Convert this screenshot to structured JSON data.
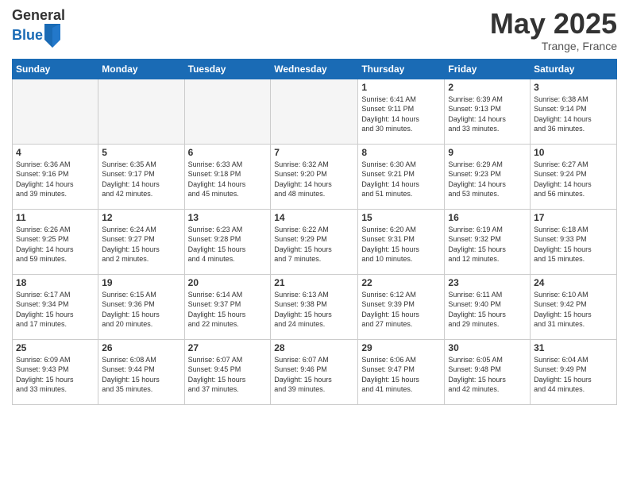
{
  "header": {
    "logo_general": "General",
    "logo_blue": "Blue",
    "month_title": "May 2025",
    "location": "Trange, France"
  },
  "weekdays": [
    "Sunday",
    "Monday",
    "Tuesday",
    "Wednesday",
    "Thursday",
    "Friday",
    "Saturday"
  ],
  "weeks": [
    [
      {
        "day": "",
        "info": ""
      },
      {
        "day": "",
        "info": ""
      },
      {
        "day": "",
        "info": ""
      },
      {
        "day": "",
        "info": ""
      },
      {
        "day": "1",
        "info": "Sunrise: 6:41 AM\nSunset: 9:11 PM\nDaylight: 14 hours\nand 30 minutes."
      },
      {
        "day": "2",
        "info": "Sunrise: 6:39 AM\nSunset: 9:13 PM\nDaylight: 14 hours\nand 33 minutes."
      },
      {
        "day": "3",
        "info": "Sunrise: 6:38 AM\nSunset: 9:14 PM\nDaylight: 14 hours\nand 36 minutes."
      }
    ],
    [
      {
        "day": "4",
        "info": "Sunrise: 6:36 AM\nSunset: 9:16 PM\nDaylight: 14 hours\nand 39 minutes."
      },
      {
        "day": "5",
        "info": "Sunrise: 6:35 AM\nSunset: 9:17 PM\nDaylight: 14 hours\nand 42 minutes."
      },
      {
        "day": "6",
        "info": "Sunrise: 6:33 AM\nSunset: 9:18 PM\nDaylight: 14 hours\nand 45 minutes."
      },
      {
        "day": "7",
        "info": "Sunrise: 6:32 AM\nSunset: 9:20 PM\nDaylight: 14 hours\nand 48 minutes."
      },
      {
        "day": "8",
        "info": "Sunrise: 6:30 AM\nSunset: 9:21 PM\nDaylight: 14 hours\nand 51 minutes."
      },
      {
        "day": "9",
        "info": "Sunrise: 6:29 AM\nSunset: 9:23 PM\nDaylight: 14 hours\nand 53 minutes."
      },
      {
        "day": "10",
        "info": "Sunrise: 6:27 AM\nSunset: 9:24 PM\nDaylight: 14 hours\nand 56 minutes."
      }
    ],
    [
      {
        "day": "11",
        "info": "Sunrise: 6:26 AM\nSunset: 9:25 PM\nDaylight: 14 hours\nand 59 minutes."
      },
      {
        "day": "12",
        "info": "Sunrise: 6:24 AM\nSunset: 9:27 PM\nDaylight: 15 hours\nand 2 minutes."
      },
      {
        "day": "13",
        "info": "Sunrise: 6:23 AM\nSunset: 9:28 PM\nDaylight: 15 hours\nand 4 minutes."
      },
      {
        "day": "14",
        "info": "Sunrise: 6:22 AM\nSunset: 9:29 PM\nDaylight: 15 hours\nand 7 minutes."
      },
      {
        "day": "15",
        "info": "Sunrise: 6:20 AM\nSunset: 9:31 PM\nDaylight: 15 hours\nand 10 minutes."
      },
      {
        "day": "16",
        "info": "Sunrise: 6:19 AM\nSunset: 9:32 PM\nDaylight: 15 hours\nand 12 minutes."
      },
      {
        "day": "17",
        "info": "Sunrise: 6:18 AM\nSunset: 9:33 PM\nDaylight: 15 hours\nand 15 minutes."
      }
    ],
    [
      {
        "day": "18",
        "info": "Sunrise: 6:17 AM\nSunset: 9:34 PM\nDaylight: 15 hours\nand 17 minutes."
      },
      {
        "day": "19",
        "info": "Sunrise: 6:15 AM\nSunset: 9:36 PM\nDaylight: 15 hours\nand 20 minutes."
      },
      {
        "day": "20",
        "info": "Sunrise: 6:14 AM\nSunset: 9:37 PM\nDaylight: 15 hours\nand 22 minutes."
      },
      {
        "day": "21",
        "info": "Sunrise: 6:13 AM\nSunset: 9:38 PM\nDaylight: 15 hours\nand 24 minutes."
      },
      {
        "day": "22",
        "info": "Sunrise: 6:12 AM\nSunset: 9:39 PM\nDaylight: 15 hours\nand 27 minutes."
      },
      {
        "day": "23",
        "info": "Sunrise: 6:11 AM\nSunset: 9:40 PM\nDaylight: 15 hours\nand 29 minutes."
      },
      {
        "day": "24",
        "info": "Sunrise: 6:10 AM\nSunset: 9:42 PM\nDaylight: 15 hours\nand 31 minutes."
      }
    ],
    [
      {
        "day": "25",
        "info": "Sunrise: 6:09 AM\nSunset: 9:43 PM\nDaylight: 15 hours\nand 33 minutes."
      },
      {
        "day": "26",
        "info": "Sunrise: 6:08 AM\nSunset: 9:44 PM\nDaylight: 15 hours\nand 35 minutes."
      },
      {
        "day": "27",
        "info": "Sunrise: 6:07 AM\nSunset: 9:45 PM\nDaylight: 15 hours\nand 37 minutes."
      },
      {
        "day": "28",
        "info": "Sunrise: 6:07 AM\nSunset: 9:46 PM\nDaylight: 15 hours\nand 39 minutes."
      },
      {
        "day": "29",
        "info": "Sunrise: 6:06 AM\nSunset: 9:47 PM\nDaylight: 15 hours\nand 41 minutes."
      },
      {
        "day": "30",
        "info": "Sunrise: 6:05 AM\nSunset: 9:48 PM\nDaylight: 15 hours\nand 42 minutes."
      },
      {
        "day": "31",
        "info": "Sunrise: 6:04 AM\nSunset: 9:49 PM\nDaylight: 15 hours\nand 44 minutes."
      }
    ]
  ]
}
